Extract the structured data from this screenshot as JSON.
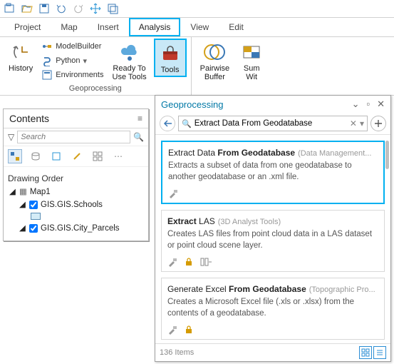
{
  "quick_access": {
    "icons": [
      "open-icon",
      "folder-icon",
      "save-icon",
      "undo-icon",
      "redo-icon",
      "pan-icon",
      "select-icon"
    ]
  },
  "ribbon": {
    "tabs": [
      {
        "label": "Project"
      },
      {
        "label": "Map"
      },
      {
        "label": "Insert"
      },
      {
        "label": "Analysis",
        "active": true
      },
      {
        "label": "View"
      },
      {
        "label": "Edit"
      }
    ],
    "geoprocessing_group": {
      "label": "Geoprocessing",
      "history": "History",
      "modelbuilder": "ModelBuilder",
      "python": "Python",
      "environments": "Environments",
      "ready": "Ready To\nUse Tools",
      "tools": "Tools"
    },
    "tools_group": {
      "pairwise": "Pairwise\nBuffer",
      "summarize": "Sum\nWit"
    }
  },
  "contents": {
    "title": "Contents",
    "search_placeholder": "Search",
    "drawing_order": "Drawing Order",
    "map": "Map1",
    "layer1": "GIS.GIS.Schools",
    "layer2": "GIS.GIS.City_Parcels"
  },
  "geo": {
    "title": "Geoprocessing",
    "search_value": "Extract Data From Geodatabase",
    "results": [
      {
        "name_html": "Extract Data <b>From Geodatabase</b>",
        "category": "(Data Management...",
        "desc": "Extracts a subset of data from one geodatabase to another geodatabase or an .xml file.",
        "highlighted": true,
        "lock": false,
        "extra": false
      },
      {
        "name_html": "<b>Extract</b> LAS",
        "category": "(3D Analyst Tools)",
        "desc": "Creates LAS files from point cloud data in a LAS dataset or point cloud scene layer.",
        "highlighted": false,
        "lock": true,
        "extra": true
      },
      {
        "name_html": "Generate Excel <b>From Geodatabase</b>",
        "category": "(Topographic Pro...",
        "desc": "Creates a Microsoft Excel file (.xls or .xlsx) from the contents of a geodatabase.",
        "highlighted": false,
        "lock": true,
        "extra": false
      }
    ],
    "items_label": "136 Items"
  }
}
